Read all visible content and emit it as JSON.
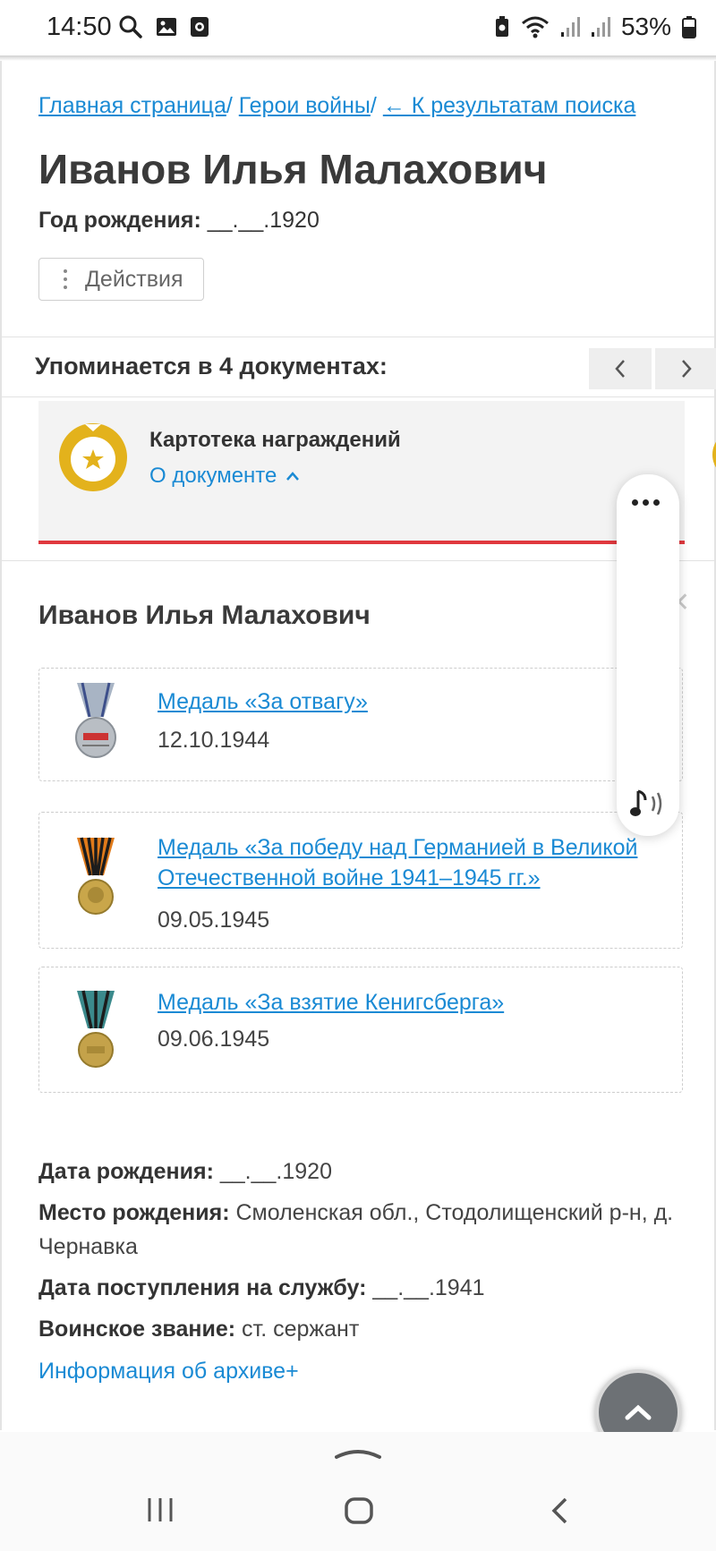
{
  "status_bar": {
    "time": "14:50",
    "battery_percent": "53%",
    "icons": [
      "search-icon",
      "gallery-icon",
      "screen-record-icon",
      "battery-saver-icon",
      "wifi-icon",
      "signal-icon",
      "signal-icon",
      "battery-icon"
    ]
  },
  "breadcrumb": {
    "home": "Главная страница",
    "heroes": "Герои войны",
    "back": "← К результатам поиска",
    "separator": "/"
  },
  "hero": {
    "name": "Иванов Илья Малахович",
    "birth_label": "Год рождения:",
    "birth_value": "__.__.1920"
  },
  "actions_button": {
    "label": "Действия"
  },
  "documents": {
    "mentions_label": "Упоминается в 4 документах:",
    "card": {
      "title": "Картотека награждений",
      "about_label": "О документе"
    }
  },
  "record": {
    "name": "Иванов Илья Малахович",
    "awards": [
      {
        "title": "Медаль «За отвагу»",
        "date": "12.10.1944"
      },
      {
        "title": "Медаль «За победу над Германией в Великой Отечественной войне 1941–1945 гг.»",
        "date": "09.05.1945"
      },
      {
        "title": "Медаль «За взятие Кенигсберга»",
        "date": "09.06.1945"
      }
    ],
    "info": {
      "birth_date_label": "Дата рождения:",
      "birth_date_value": "__.__.1920",
      "birth_place_label": "Место рождения:",
      "birth_place_value": "Смоленская обл., Стодолищенский р-н, д. Чернавка",
      "service_date_label": "Дата поступления на службу:",
      "service_date_value": "__.__.1941",
      "rank_label": "Воинское звание:",
      "rank_value": "ст. сержант"
    },
    "archive_link": "Информация об архиве+"
  },
  "colors": {
    "link": "#1a8ad4",
    "accent_red": "#e0383e",
    "emblem_gold": "#e3b21c",
    "card_bg": "#f3f3f3"
  }
}
